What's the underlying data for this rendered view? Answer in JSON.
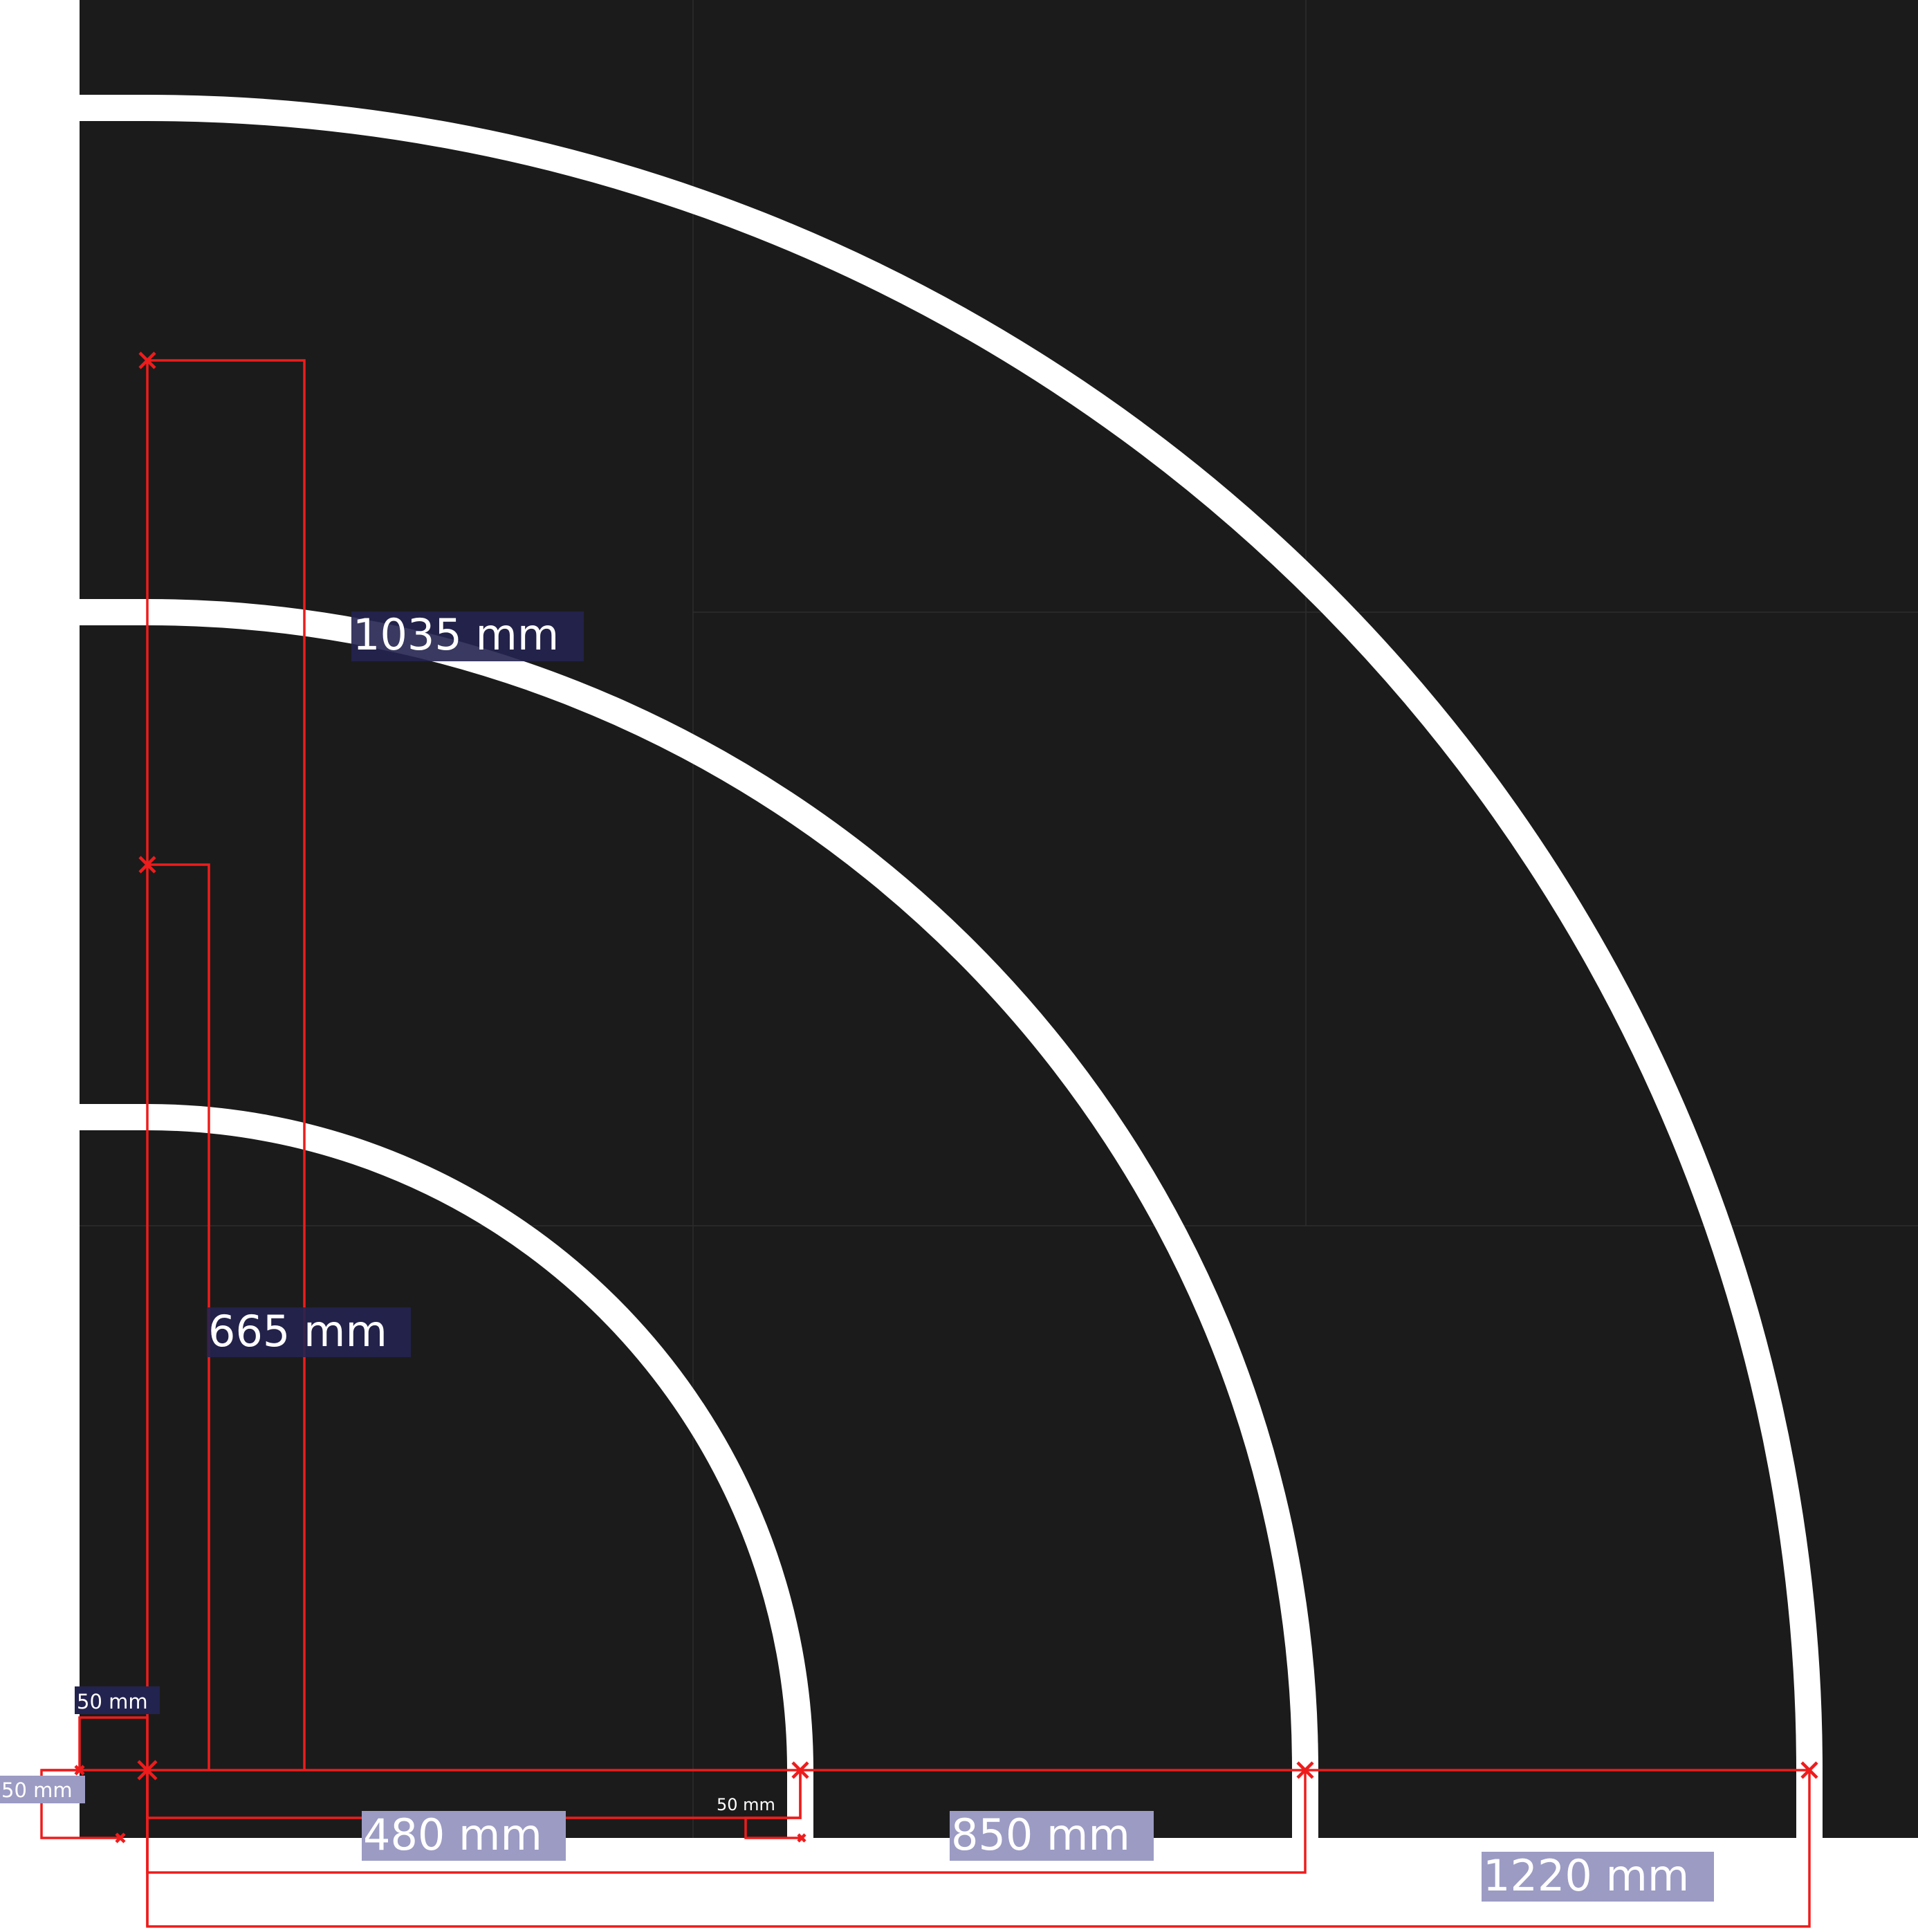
{
  "colors": {
    "board": "#1b1b1b",
    "track": "#ffffff",
    "dimension_line": "#ee1c1c",
    "label_dark_bg": "#232350",
    "label_light_bg": "#9b9bc4",
    "label_text": "#ffffff"
  },
  "dimensions": {
    "radius_inner": "480 mm",
    "radius_middle": "850 mm",
    "radius_outer": "1220 mm",
    "vertical_inner": "665 mm",
    "vertical_middle": "1035 mm",
    "margin_left": "50 mm",
    "margin_bottom": "50 mm",
    "track_width": "50 mm"
  }
}
